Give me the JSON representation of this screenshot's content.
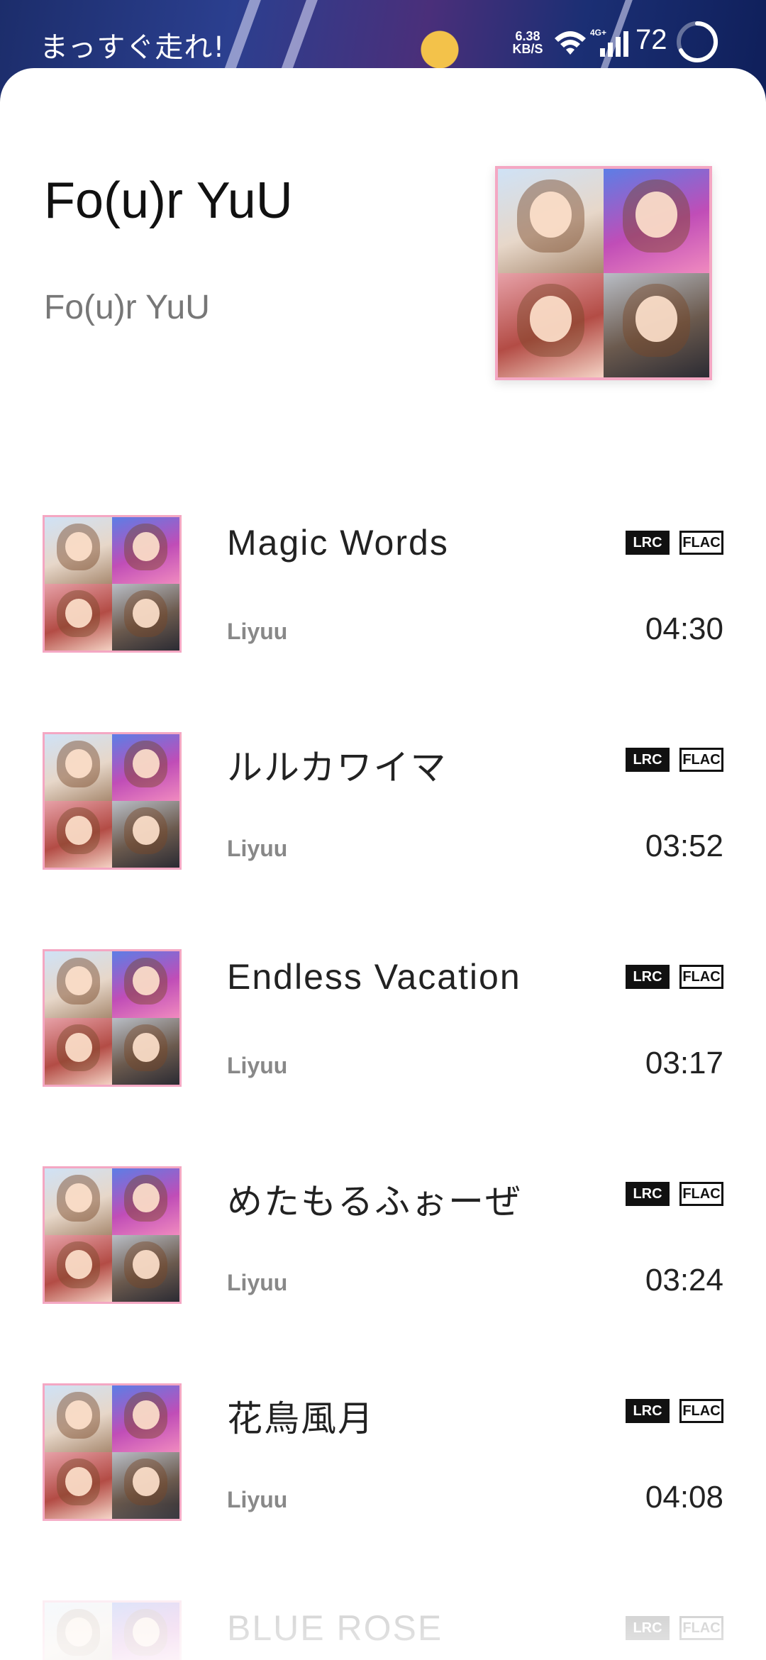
{
  "status_bar": {
    "now_playing": "まっすぐ走れ!",
    "net_speed_value": "6.38",
    "net_speed_unit": "KB/S",
    "network_type": "4G+",
    "battery": "72"
  },
  "album": {
    "title": "Fo(u)r YuU",
    "artist": "Fo(u)r YuU",
    "accent_color": "#f4a7c3"
  },
  "tracks": [
    {
      "title": "Magic Words",
      "artist": "Liyuu",
      "duration": "04:30",
      "tags": [
        "LRC",
        "FLAC"
      ]
    },
    {
      "title": "ルルカワイマ",
      "artist": "Liyuu",
      "duration": "03:52",
      "tags": [
        "LRC",
        "FLAC"
      ]
    },
    {
      "title": "Endless Vacation",
      "artist": "Liyuu",
      "duration": "03:17",
      "tags": [
        "LRC",
        "FLAC"
      ]
    },
    {
      "title": "めたもるふぉーぜ",
      "artist": "Liyuu",
      "duration": "03:24",
      "tags": [
        "LRC",
        "FLAC"
      ]
    },
    {
      "title": "花鳥風月",
      "artist": "Liyuu",
      "duration": "04:08",
      "tags": [
        "LRC",
        "FLAC"
      ]
    },
    {
      "title": "BLUE ROSE",
      "tags": [
        "LRC",
        "FLAC"
      ]
    }
  ]
}
